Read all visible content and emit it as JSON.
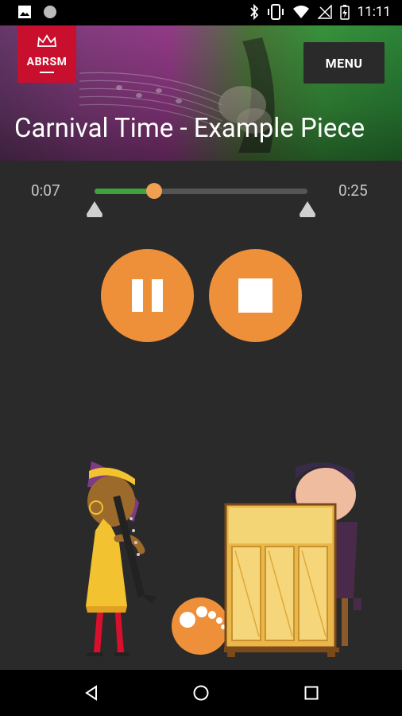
{
  "status_bar": {
    "time": "11:11",
    "left_icons": [
      "image-icon",
      "circle-icon"
    ],
    "right_icons": [
      "bluetooth-icon",
      "vibrate-icon",
      "wifi-icon",
      "no-signal-icon",
      "battery-charging-icon"
    ]
  },
  "header": {
    "logo_text": "ABRSM",
    "menu_label": "MENU",
    "title": "Carnival Time - Example Piece"
  },
  "player": {
    "elapsed": "0:07",
    "total": "0:25",
    "progress_fraction": 0.28,
    "loop_start_fraction": 0.0,
    "loop_end_fraction": 1.0,
    "pause_icon": "pause-icon",
    "stop_icon": "stop-icon"
  },
  "colors": {
    "accent_orange": "#ee8f3a",
    "progress_green": "#3da33a",
    "logo_red": "#c8102e",
    "background": "#2a2a2a"
  },
  "nav_bar": {
    "icons": [
      "back-icon",
      "home-icon",
      "recents-icon"
    ]
  }
}
